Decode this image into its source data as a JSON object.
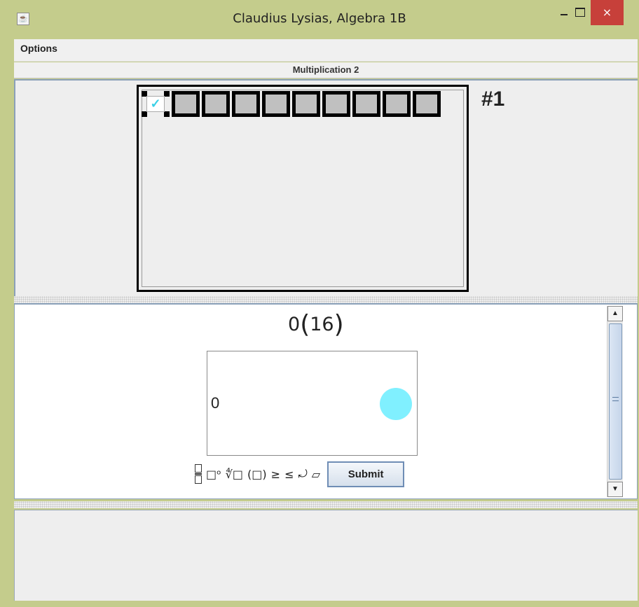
{
  "window": {
    "title": "Claudius Lysias, Algebra 1B",
    "app_icon": "java-icon",
    "controls": {
      "minimize": "minimize-icon",
      "maximize": "maximize-icon",
      "close": "×"
    }
  },
  "menubar": {
    "options_label": "Options"
  },
  "section": {
    "title": "Multiplication 2"
  },
  "progress": {
    "total": 10,
    "completed": 1,
    "check_mark": "✓",
    "problem_label": "#1"
  },
  "problem": {
    "left": "0",
    "open_paren": "(",
    "inner": "16",
    "close_paren": ")"
  },
  "answer": {
    "value": "0",
    "indicator_color": "#80f0ff"
  },
  "toolbar": {
    "superscript": "□ᵒ",
    "root": "∜□",
    "parens": "(□)",
    "ge": "≥",
    "le": "≤",
    "undo": "⤾",
    "erase": "⏥",
    "submit_label": "Submit"
  },
  "scrollbar": {
    "up": "▲",
    "down": "▼",
    "grip": "≡"
  }
}
